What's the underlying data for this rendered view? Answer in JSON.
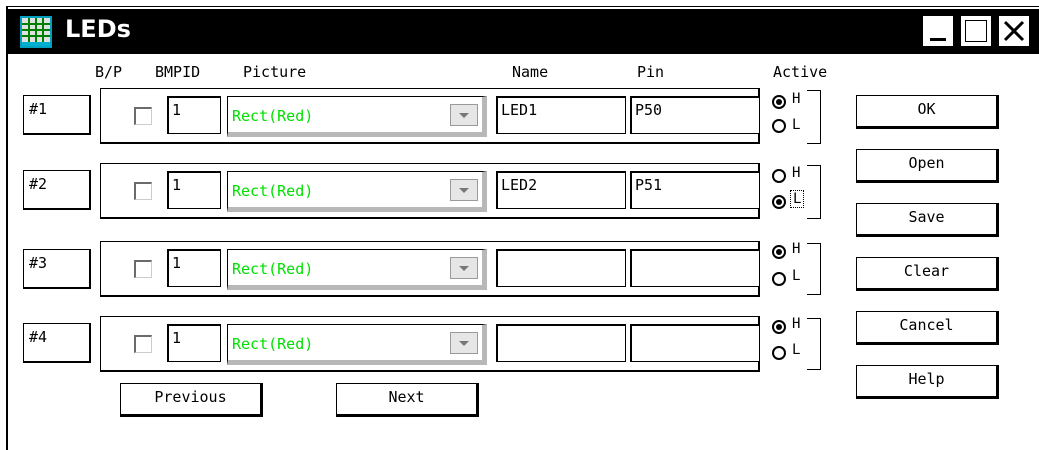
{
  "window": {
    "title": "LEDs"
  },
  "headers": {
    "bp": "B/P",
    "bmpid": "BMPID",
    "picture": "Picture",
    "name": "Name",
    "pin": "Pin",
    "active": "Active"
  },
  "rows": [
    {
      "num": "#1",
      "bmpid": "1",
      "picture": "Rect(Red)",
      "name": "LED1",
      "pin": "P50",
      "active": "H"
    },
    {
      "num": "#2",
      "bmpid": "1",
      "picture": "Rect(Red)",
      "name": "LED2",
      "pin": "P51",
      "active": "L"
    },
    {
      "num": "#3",
      "bmpid": "1",
      "picture": "Rect(Red)",
      "name": "",
      "pin": "",
      "active": "H"
    },
    {
      "num": "#4",
      "bmpid": "1",
      "picture": "Rect(Red)",
      "name": "",
      "pin": "",
      "active": "H"
    }
  ],
  "radio_labels": {
    "high": "H",
    "low": "L"
  },
  "buttons": {
    "ok": "OK",
    "open": "Open",
    "save": "Save",
    "clear": "Clear",
    "cancel": "Cancel",
    "help": "Help",
    "previous": "Previous",
    "next": "Next"
  },
  "colors": {
    "picture_text": "#00e000",
    "titlebar": "#000000"
  }
}
